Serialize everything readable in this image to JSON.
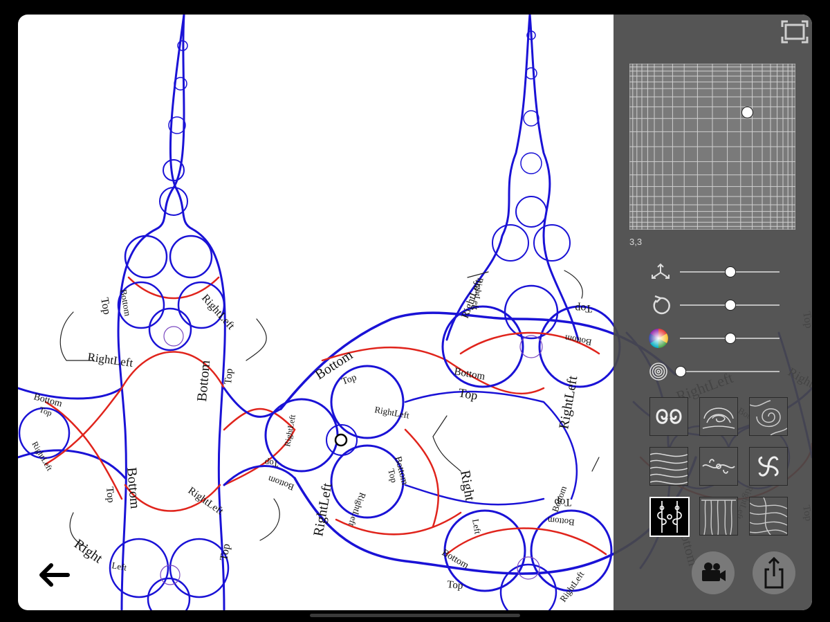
{
  "canvas": {
    "labels": {
      "top": "Top",
      "bottom": "Bottom",
      "right_left": "RightLeft",
      "right": "Right",
      "left": "Left"
    },
    "colors": {
      "blue": "#1a12d6",
      "red": "#e0241c",
      "background": "#ffffff"
    }
  },
  "panel": {
    "fullscreen_icon": "fullscreen-icon",
    "grid_value_label": "3,3",
    "grid_position": {
      "col": 0.71,
      "row": 0.29
    },
    "sliders": [
      {
        "name": "move",
        "icon": "move-arrows-icon",
        "value": 0.5
      },
      {
        "name": "rotate",
        "icon": "rotate-icon",
        "value": 0.5
      },
      {
        "name": "color",
        "icon": "color-wheel-icon",
        "value": 0.5
      },
      {
        "name": "spiral",
        "icon": "spiral-icon",
        "value": 0.0
      }
    ],
    "patterns": [
      {
        "icon": "pattern-curl-icon",
        "selected": false
      },
      {
        "icon": "pattern-swirl-icon",
        "selected": false
      },
      {
        "icon": "pattern-spiral-icon",
        "selected": false
      },
      {
        "icon": "pattern-waves-icon",
        "selected": false
      },
      {
        "icon": "pattern-ornament-icon",
        "selected": false
      },
      {
        "icon": "pattern-pinwheel-icon",
        "selected": false
      },
      {
        "icon": "pattern-filigree-icon",
        "selected": true
      },
      {
        "icon": "pattern-curtain-icon",
        "selected": false
      },
      {
        "icon": "pattern-marble-icon",
        "selected": false
      }
    ],
    "buttons": {
      "record": "video-camera-icon",
      "share": "share-icon"
    }
  },
  "nav": {
    "back_icon": "back-arrow-icon"
  }
}
